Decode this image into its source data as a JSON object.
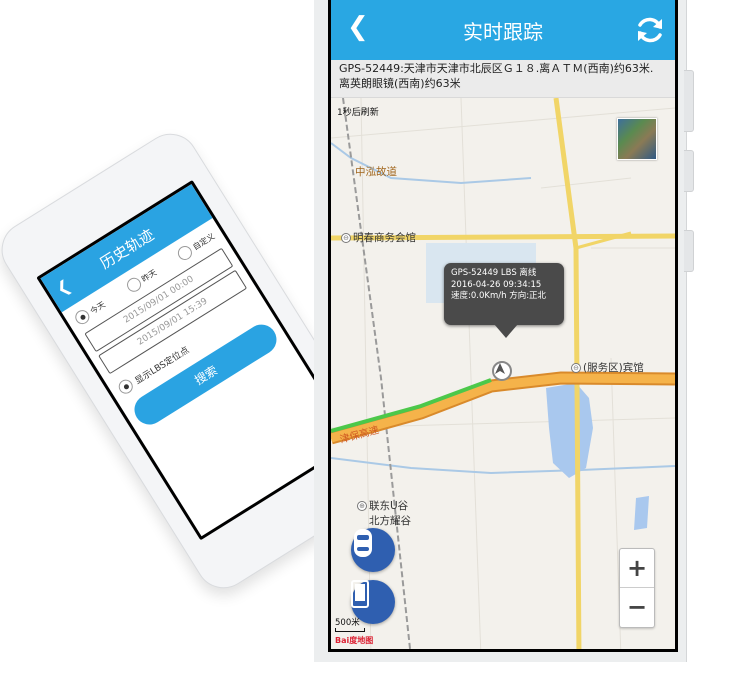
{
  "history_phone": {
    "title": "历史轨迹",
    "back_icon": "chevron-left-icon",
    "radios": [
      {
        "label": "今天",
        "selected": true
      },
      {
        "label": "昨天",
        "selected": false
      },
      {
        "label": "自定义",
        "selected": false
      }
    ],
    "start_time": "2015/09/01 00:00",
    "end_time": "2015/09/01 15:39",
    "lbs_label": "显示LBS定位点",
    "search_label": "搜索",
    "accent": "#2aa3e2"
  },
  "realtime_phone": {
    "title": "实时跟踪",
    "back_icon": "chevron-left-icon",
    "refresh_icon": "refresh-icon",
    "address_line1": "GPS-52449:天津市天津市北辰区Ｇ１８.离ＡＴＭ(西南)约63米.",
    "address_line2": "离英朗眼镜(西南)约63米",
    "refresh_note": "1秒后刷新",
    "map": {
      "pois": {
        "zhonghong": "中泓故道",
        "mingchun": "明春商务会馆",
        "fuwuqu": "(服务区)宾馆",
        "liandong1": "联东U谷",
        "liandong2": "北方耀谷",
        "road": "津保高速"
      },
      "bubble": {
        "line1": "GPS-52449 LBS 离线",
        "line2": "2016-04-26 09:34:15",
        "line3": "速度:0.0Km/h  方向:正北"
      },
      "scale_label": "500米",
      "provider": "Bai度地图"
    },
    "zoom_in": "+",
    "zoom_out": "−",
    "accent": "#29a7e3",
    "fab_color": "#2f5fb0"
  }
}
